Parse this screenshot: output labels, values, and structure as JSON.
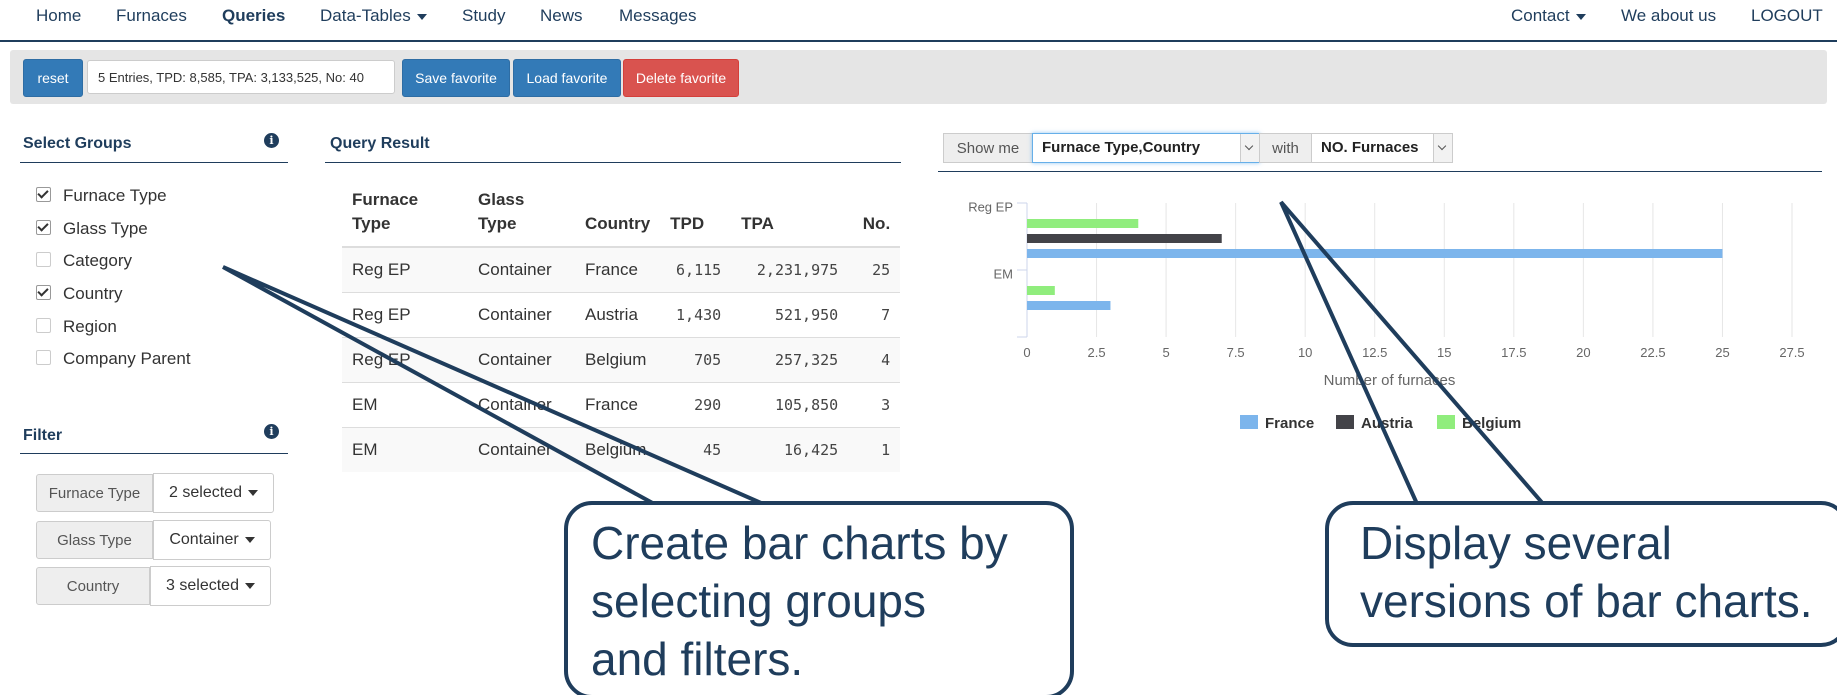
{
  "nav": {
    "home": "Home",
    "furnaces": "Furnaces",
    "queries": "Queries",
    "data_tables": "Data-Tables",
    "study": "Study",
    "news": "News",
    "messages": "Messages",
    "contact": "Contact",
    "we_about_us": "We about us",
    "logout": "LOGOUT"
  },
  "toolbar": {
    "reset": "reset",
    "summary": "5 Entries, TPD: 8,585, TPA: 3,133,525, No: 40",
    "save_favorite": "Save favorite",
    "load_favorite": "Load favorite",
    "delete_favorite": "Delete favorite"
  },
  "select_groups": {
    "title": "Select Groups",
    "items": [
      {
        "label": "Furnace Type",
        "checked": true
      },
      {
        "label": "Glass Type",
        "checked": true
      },
      {
        "label": "Category",
        "checked": false
      },
      {
        "label": "Country",
        "checked": true
      },
      {
        "label": "Region",
        "checked": false
      },
      {
        "label": "Company Parent",
        "checked": false
      }
    ]
  },
  "filter": {
    "title": "Filter",
    "rows": [
      {
        "label": "Furnace Type",
        "value": "2 selected"
      },
      {
        "label": "Glass Type",
        "value": "Container"
      },
      {
        "label": "Country",
        "value": "3 selected"
      }
    ]
  },
  "query_result": {
    "title": "Query Result",
    "headers": [
      "Furnace Type",
      "Glass Type",
      "Country",
      "TPD",
      "TPA",
      "No."
    ],
    "rows": [
      [
        "Reg EP",
        "Container",
        "France",
        "6,115",
        "2,231,975",
        "25"
      ],
      [
        "Reg EP",
        "Container",
        "Austria",
        "1,430",
        "521,950",
        "7"
      ],
      [
        "Reg EP",
        "Container",
        "Belgium",
        "705",
        "257,325",
        "4"
      ],
      [
        "EM",
        "Container",
        "France",
        "290",
        "105,850",
        "3"
      ],
      [
        "EM",
        "Container",
        "Belgium",
        "45",
        "16,425",
        "1"
      ]
    ]
  },
  "chart_controls": {
    "show_me": "Show me",
    "group_value": "Furnace Type,Country",
    "with": "with",
    "metric_value": "NO. Furnaces"
  },
  "chart_data": {
    "type": "bar",
    "orientation": "horizontal",
    "categories": [
      "Reg EP",
      "EM"
    ],
    "series": [
      {
        "name": "France",
        "color": "#7cb5ec",
        "values": [
          25,
          3
        ]
      },
      {
        "name": "Austria",
        "color": "#434348",
        "values": [
          7,
          0
        ]
      },
      {
        "name": "Belgium",
        "color": "#90ed7d",
        "values": [
          4,
          1
        ]
      }
    ],
    "xlabel": "Number of furnaces",
    "xlim": [
      0,
      27.5
    ],
    "xticks": [
      "0",
      "2.5",
      "5",
      "7.5",
      "10",
      "12.5",
      "15",
      "17.5",
      "20",
      "22.5",
      "25",
      "27.5"
    ],
    "grid": true,
    "legend_position": "bottom"
  },
  "callouts": {
    "left_line1": "Create bar charts by",
    "left_line2": "selecting groups",
    "left_line3": "and filters.",
    "right_line1": "Display several",
    "right_line2": "versions of bar charts."
  },
  "colors": {
    "brand": "#1f3d5c",
    "primary_button": "#337ab7",
    "danger_button": "#d9534f"
  }
}
